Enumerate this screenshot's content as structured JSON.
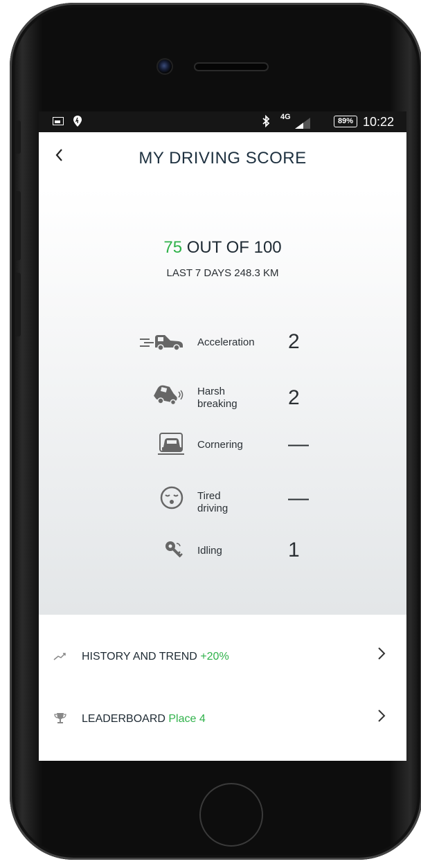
{
  "status_bar": {
    "network": "4G",
    "battery": "89%",
    "time": "10:22"
  },
  "header": {
    "back_icon": "chevron-left-icon",
    "title": "MY DRIVING SCORE"
  },
  "score": {
    "value": "75",
    "suffix": " OUT OF 100",
    "period": "LAST 7 DAYS 248.3 KM"
  },
  "metrics": [
    {
      "label": "Acceleration",
      "value": "2",
      "icon": "acceleration-car-icon"
    },
    {
      "label": "Harsh\nbreaking",
      "value": "2",
      "icon": "harsh-braking-car-icon"
    },
    {
      "label": "Cornering",
      "value": "—",
      "icon": "cornering-car-icon"
    },
    {
      "label": "Tired\ndriving",
      "value": "—",
      "icon": "tired-face-icon"
    },
    {
      "label": "Idling",
      "value": "1",
      "icon": "idling-key-icon"
    }
  ],
  "menu": {
    "history": {
      "label": "HISTORY AND TREND ",
      "accent": "+20%",
      "icon": "trend-icon"
    },
    "leaderboard": {
      "label": "LEADERBOARD ",
      "accent": "Place 4",
      "icon": "trophy-icon"
    }
  },
  "colors": {
    "accent_green": "#2fb24a",
    "title": "#1e3140"
  }
}
